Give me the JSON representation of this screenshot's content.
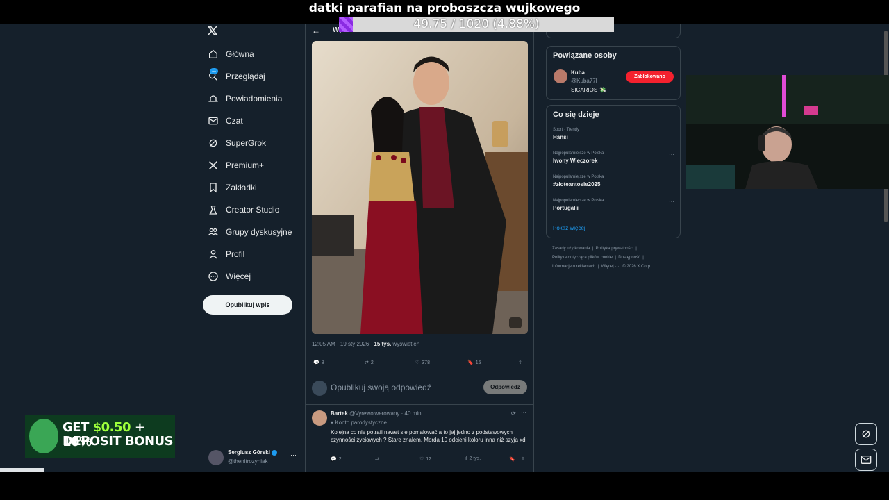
{
  "stream": {
    "title": "datki parafian na proboszcza wujkowego",
    "goal_text": "49.75 / 1020 (4.88%)",
    "goal_fraction": 0.0488
  },
  "nav": {
    "items": [
      {
        "label": "Główna",
        "icon": "home-icon"
      },
      {
        "label": "Przeglądaj",
        "icon": "search-icon"
      },
      {
        "label": "Powiadomienia",
        "icon": "bell-icon"
      },
      {
        "label": "Czat",
        "icon": "mail-icon"
      },
      {
        "label": "SuperGrok",
        "icon": "grok-icon"
      },
      {
        "label": "Premium+",
        "icon": "x-logo-icon"
      },
      {
        "label": "Zakładki",
        "icon": "bookmark-icon"
      },
      {
        "label": "Creator Studio",
        "icon": "creator-icon"
      },
      {
        "label": "Grupy dyskusyjne",
        "icon": "groups-icon"
      },
      {
        "label": "Profil",
        "icon": "profile-icon"
      },
      {
        "label": "Więcej",
        "icon": "more-icon"
      }
    ],
    "notif_badge": "11",
    "post_button": "Opublikuj wpis"
  },
  "account": {
    "name": "Sergiusz Górski",
    "handle": "@thenitrozyniak",
    "more": "···"
  },
  "post": {
    "header": "Wpis",
    "time": "12:05 AM · 19 sty 2026 · ",
    "views_count": "15 tys.",
    "views_label": " wyświetleń",
    "replies": "8",
    "reposts": "2",
    "likes": "378",
    "bookmarks": "15"
  },
  "reply_box": {
    "placeholder": "Opublikuj swoją odpowiedź",
    "button": "Odpowiedz"
  },
  "comment": {
    "name": "Bartek",
    "handle": "@Vyrewolwerowany · 40 min",
    "label": "Konto parodystyczne",
    "text": "Kolejna co nie potrafi nawet się pomalować a to jej jedno z podstawowych czynności życiowych ? Stare znałem. Morda 10 odcieni koloru inna niż szyja xd",
    "replies": "2",
    "likes": "12",
    "views": "2 tys."
  },
  "related": {
    "title": "Powiązane osoby",
    "name": "Kuba",
    "handle": "@Kuba77l",
    "bio": "SICARIOS 💸",
    "button": "Zablokowano"
  },
  "trends": {
    "title": "Co się dzieje",
    "items": [
      {
        "category": "Sport · Trendy",
        "name": "Hansi"
      },
      {
        "category": "Najpopularniejsze w Polska",
        "name": "Iwony Wieczorek"
      },
      {
        "category": "Najpopularniejsze w Polska",
        "name": "#złoteantosie2025"
      },
      {
        "category": "Najpopularniejsze w Polska",
        "name": "Portugalii"
      }
    ],
    "more": "···",
    "show_more": "Pokaż więcej"
  },
  "footer": {
    "l1a": "Zasady użytkowania",
    "l1b": "Polityka prywatności",
    "l2a": "Polityka dotycząca plików cookie",
    "l2b": "Dostępność",
    "l3a": "Informacje o reklamach",
    "l3b": "Więcej ···",
    "l3c": "© 2026 X Corp."
  },
  "ad": {
    "line1a": "GET ",
    "line1b": "$0.50",
    "line1c": " + 10%",
    "line2": "DEPOSIT BONUS"
  },
  "colors": {
    "accent": "#1d9bf0",
    "blocked": "#f4212e",
    "bg": "#15202b"
  }
}
